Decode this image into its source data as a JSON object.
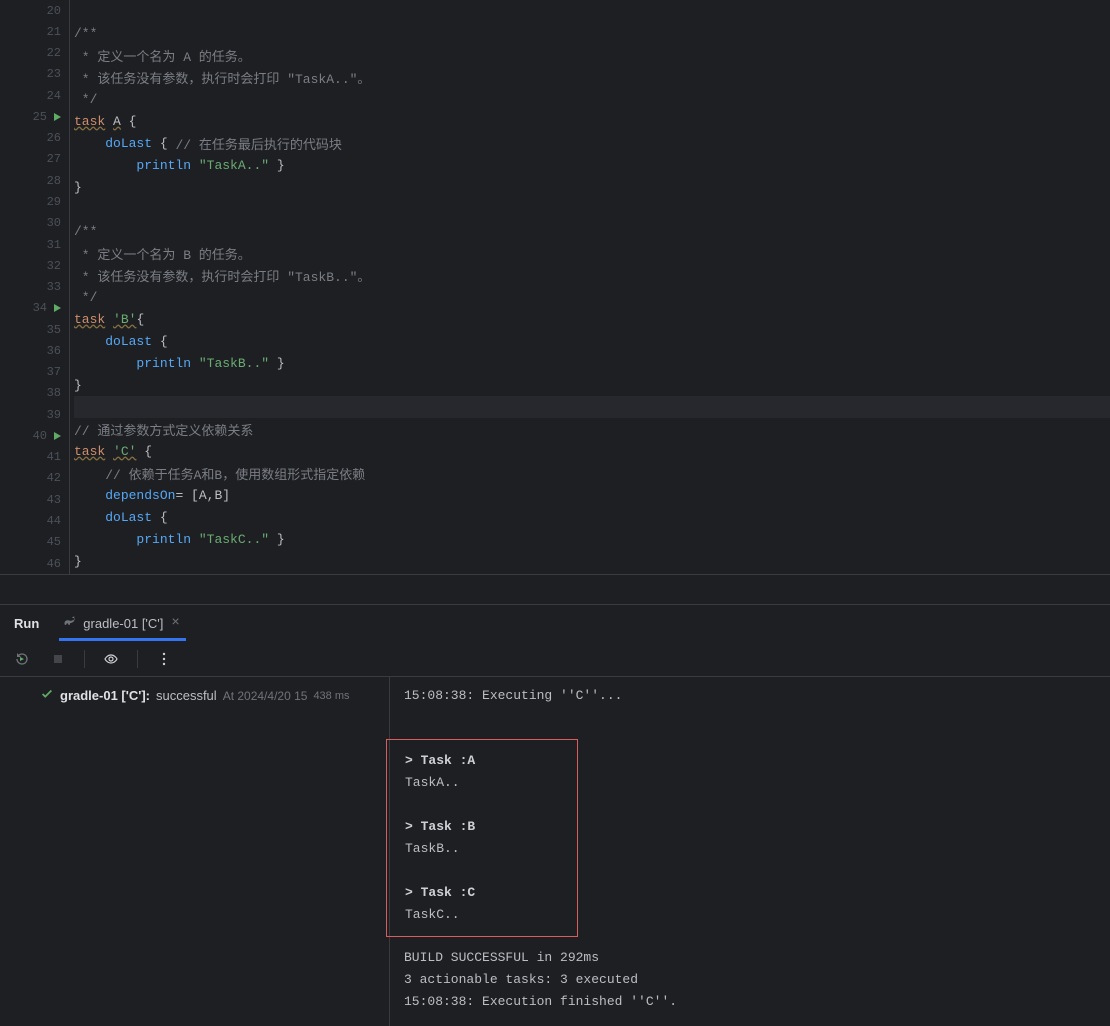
{
  "editor": {
    "startLine": 20,
    "currentLine": 38,
    "runLines": [
      25,
      34,
      40
    ],
    "lines": [
      {
        "n": 20,
        "tokens": []
      },
      {
        "n": 21,
        "tokens": [
          {
            "t": "/**",
            "c": "c-comment"
          }
        ]
      },
      {
        "n": 22,
        "tokens": [
          {
            "t": " * 定义一个名为 A 的任务。",
            "c": "c-comment"
          }
        ]
      },
      {
        "n": 23,
        "tokens": [
          {
            "t": " * 该任务没有参数，执行时会打印 \"TaskA..\"。",
            "c": "c-comment"
          }
        ]
      },
      {
        "n": 24,
        "tokens": [
          {
            "t": " */",
            "c": "c-comment"
          }
        ]
      },
      {
        "n": 25,
        "tokens": [
          {
            "t": "task",
            "c": "c-keyword c-warn"
          },
          {
            "t": " "
          },
          {
            "t": "A",
            "c": "c-identifier c-warn"
          },
          {
            "t": " "
          },
          {
            "t": "{",
            "c": "c-brace"
          }
        ]
      },
      {
        "n": 26,
        "tokens": [
          {
            "t": "    "
          },
          {
            "t": "doLast",
            "c": "c-method"
          },
          {
            "t": " "
          },
          {
            "t": "{",
            "c": "c-brace"
          },
          {
            "t": " "
          },
          {
            "t": "// 在任务最后执行的代码块",
            "c": "c-comment"
          }
        ]
      },
      {
        "n": 27,
        "tokens": [
          {
            "t": "        "
          },
          {
            "t": "println",
            "c": "c-method"
          },
          {
            "t": " "
          },
          {
            "t": "\"TaskA..\"",
            "c": "c-string"
          },
          {
            "t": " "
          },
          {
            "t": "}",
            "c": "c-brace"
          }
        ]
      },
      {
        "n": 28,
        "tokens": [
          {
            "t": "}",
            "c": "c-brace"
          }
        ]
      },
      {
        "n": 29,
        "tokens": []
      },
      {
        "n": 30,
        "tokens": [
          {
            "t": "/**",
            "c": "c-comment"
          }
        ]
      },
      {
        "n": 31,
        "tokens": [
          {
            "t": " * 定义一个名为 B 的任务。",
            "c": "c-comment"
          }
        ]
      },
      {
        "n": 32,
        "tokens": [
          {
            "t": " * 该任务没有参数，执行时会打印 \"TaskB..\"。",
            "c": "c-comment"
          }
        ]
      },
      {
        "n": 33,
        "tokens": [
          {
            "t": " */",
            "c": "c-comment"
          }
        ]
      },
      {
        "n": 34,
        "tokens": [
          {
            "t": "task",
            "c": "c-keyword c-warn"
          },
          {
            "t": " "
          },
          {
            "t": "'B'",
            "c": "c-string c-warn"
          },
          {
            "t": "{",
            "c": "c-brace"
          }
        ]
      },
      {
        "n": 35,
        "tokens": [
          {
            "t": "    "
          },
          {
            "t": "doLast",
            "c": "c-method"
          },
          {
            "t": " "
          },
          {
            "t": "{",
            "c": "c-brace"
          }
        ]
      },
      {
        "n": 36,
        "tokens": [
          {
            "t": "        "
          },
          {
            "t": "println",
            "c": "c-method"
          },
          {
            "t": " "
          },
          {
            "t": "\"TaskB..\"",
            "c": "c-string"
          },
          {
            "t": " "
          },
          {
            "t": "}",
            "c": "c-brace"
          }
        ]
      },
      {
        "n": 37,
        "tokens": [
          {
            "t": "}",
            "c": "c-brace"
          }
        ]
      },
      {
        "n": 38,
        "tokens": []
      },
      {
        "n": 39,
        "tokens": [
          {
            "t": "// 通过参数方式定义依赖关系",
            "c": "c-comment"
          }
        ]
      },
      {
        "n": 40,
        "tokens": [
          {
            "t": "task",
            "c": "c-keyword c-warn"
          },
          {
            "t": " "
          },
          {
            "t": "'C'",
            "c": "c-string c-warn"
          },
          {
            "t": " "
          },
          {
            "t": "{",
            "c": "c-brace"
          }
        ]
      },
      {
        "n": 41,
        "tokens": [
          {
            "t": "    "
          },
          {
            "t": "// 依赖于任务A和B，使用数组形式指定依赖",
            "c": "c-comment"
          }
        ]
      },
      {
        "n": 42,
        "tokens": [
          {
            "t": "    "
          },
          {
            "t": "dependsOn",
            "c": "c-method"
          },
          {
            "t": "= ["
          },
          {
            "t": "A",
            "c": "c-identifier"
          },
          {
            "t": ","
          },
          {
            "t": "B",
            "c": "c-identifier"
          },
          {
            "t": "]"
          }
        ]
      },
      {
        "n": 43,
        "tokens": [
          {
            "t": "    "
          },
          {
            "t": "doLast",
            "c": "c-method"
          },
          {
            "t": " "
          },
          {
            "t": "{",
            "c": "c-brace"
          }
        ]
      },
      {
        "n": 44,
        "tokens": [
          {
            "t": "        "
          },
          {
            "t": "println",
            "c": "c-method"
          },
          {
            "t": " "
          },
          {
            "t": "\"TaskC..\"",
            "c": "c-string"
          },
          {
            "t": " "
          },
          {
            "t": "}",
            "c": "c-brace"
          }
        ]
      },
      {
        "n": 45,
        "tokens": [
          {
            "t": "}",
            "c": "c-brace"
          }
        ]
      },
      {
        "n": 46,
        "tokens": []
      }
    ]
  },
  "runPanel": {
    "panelLabel": "Run",
    "tabName": "gradle-01 ['C']",
    "tree": {
      "name": "gradle-01 ['C']:",
      "status": "successful",
      "at": "At 2024/4/20 15",
      "duration": "438 ms"
    },
    "console": {
      "header": "15:08:38: Executing ''C''...",
      "highlighted": [
        "> Task :A",
        "TaskA..",
        "",
        "> Task :B",
        "TaskB..",
        "",
        "> Task :C",
        "TaskC.."
      ],
      "footer": [
        "BUILD SUCCESSFUL in 292ms",
        "3 actionable tasks: 3 executed",
        "15:08:38: Execution finished ''C''."
      ]
    }
  }
}
